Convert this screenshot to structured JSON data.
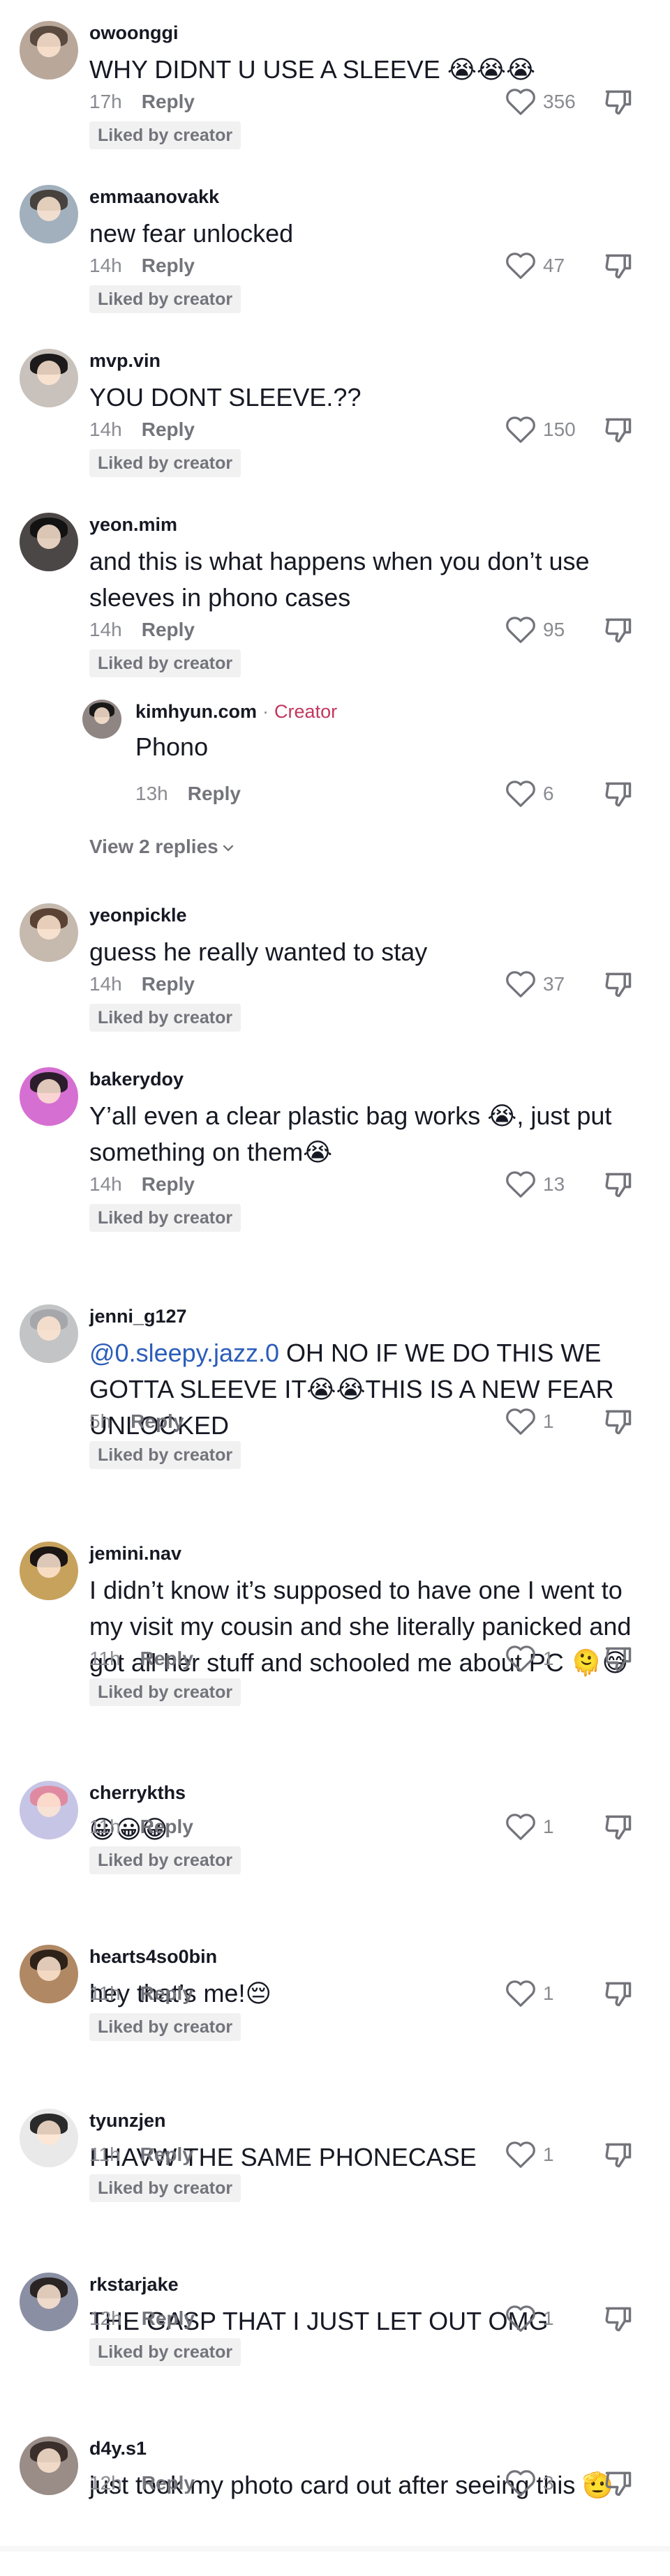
{
  "comments": [
    {
      "username": "owoonggi",
      "text": "WHY DIDNT U USE A SLEEVE 😭😭😭",
      "time": "17h",
      "reply": "Reply",
      "likes": "356",
      "liked_by_creator": "Liked by creator",
      "avatar_colors": [
        "#b9a89a",
        "#5a4a40"
      ]
    },
    {
      "username": "emmaanovakk",
      "text": "new fear unlocked",
      "time": "14h",
      "reply": "Reply",
      "likes": "47",
      "liked_by_creator": "Liked by creator",
      "avatar_colors": [
        "#a2b0bd",
        "#47423e"
      ]
    },
    {
      "username": "mvp.vin",
      "text": "YOU DONT SLEEVE.??",
      "time": "14h",
      "reply": "Reply",
      "likes": "150",
      "liked_by_creator": "Liked by creator",
      "avatar_colors": [
        "#c9c2bc",
        "#1c1a1a"
      ]
    },
    {
      "username": "yeon.mim",
      "text": "and this is what happens when you don’t use sleeves in phono cases",
      "time": "14h",
      "reply": "Reply",
      "likes": "95",
      "liked_by_creator": "Liked by creator",
      "avatar_colors": [
        "#4b4747",
        "#121212"
      ]
    },
    {
      "username": "kimhyun.com",
      "creator_label": "Creator",
      "separator": "·",
      "text": "Phono",
      "time": "13h",
      "reply": "Reply",
      "likes": "6",
      "avatar_colors": [
        "#8f8583",
        "#191818"
      ]
    },
    {
      "username": "yeonpickle",
      "text": "guess he really wanted to stay",
      "time": "14h",
      "reply": "Reply",
      "likes": "37",
      "liked_by_creator": "Liked by creator",
      "avatar_colors": [
        "#c6b9ae",
        "#5a4335"
      ]
    },
    {
      "username": "bakerydoy",
      "text": "Y’all even a clear plastic bag works 😭, just put something on them😭",
      "time": "14h",
      "reply": "Reply",
      "likes": "13",
      "liked_by_creator": "Liked by creator",
      "avatar_colors": [
        "#d66fd2",
        "#2c1d2d"
      ]
    },
    {
      "username": "jenni_g127",
      "mention": "@0.sleepy.jazz.0",
      "text": " OH NO IF WE DO THIS WE GOTTA SLEEVE IT😭😭THIS IS A NEW FEAR UNLOCKED",
      "time": "5h",
      "reply": "Reply",
      "likes": "1",
      "liked_by_creator": "Liked by creator",
      "avatar_colors": [
        "#c3c4c6",
        "#a6a7aa"
      ]
    },
    {
      "username": "jemini.nav",
      "text": "I didn’t know it’s supposed to have one I went to my visit my cousin and she literally panicked and got all her stuff and schooled me about PC 🫠😅",
      "time": "11h",
      "reply": "Reply",
      "likes": "1",
      "liked_by_creator": "Liked by creator",
      "avatar_colors": [
        "#c7a25c",
        "#1b1514"
      ]
    },
    {
      "username": "cherrykths",
      "text": "😀😀😀",
      "time": "11h",
      "reply": "Reply",
      "likes": "1",
      "liked_by_creator": "Liked by creator",
      "avatar_colors": [
        "#c6c5e6",
        "#e08aa2"
      ]
    },
    {
      "username": "hearts4so0bin",
      "text": "hey that’s me!😔",
      "time": "11h",
      "reply": "Reply",
      "likes": "1",
      "liked_by_creator": "Liked by creator",
      "avatar_colors": [
        "#b08864",
        "#2e2118"
      ]
    },
    {
      "username": "tyunzjen",
      "text": "I HAVW THE SAME PHONECASE",
      "time": "11h",
      "reply": "Reply",
      "likes": "1",
      "liked_by_creator": "Liked by creator",
      "avatar_colors": [
        "#e9e9e9",
        "#2a2a2a"
      ]
    },
    {
      "username": "rkstarjake",
      "text": "THE GASP THAT I JUST LET OUT OMG",
      "time": "12h",
      "reply": "Reply",
      "likes": "1",
      "liked_by_creator": "Liked by creator",
      "avatar_colors": [
        "#8a8fa3",
        "#2a2424"
      ]
    },
    {
      "username": "d4y.s1",
      "text": "just took my photo card out after seeing this 🫡",
      "time": "12h",
      "reply": "Reply",
      "likes": "3",
      "avatar_colors": [
        "#9a8c86",
        "#3b2f2b"
      ]
    }
  ],
  "view_replies": "View 2 replies"
}
